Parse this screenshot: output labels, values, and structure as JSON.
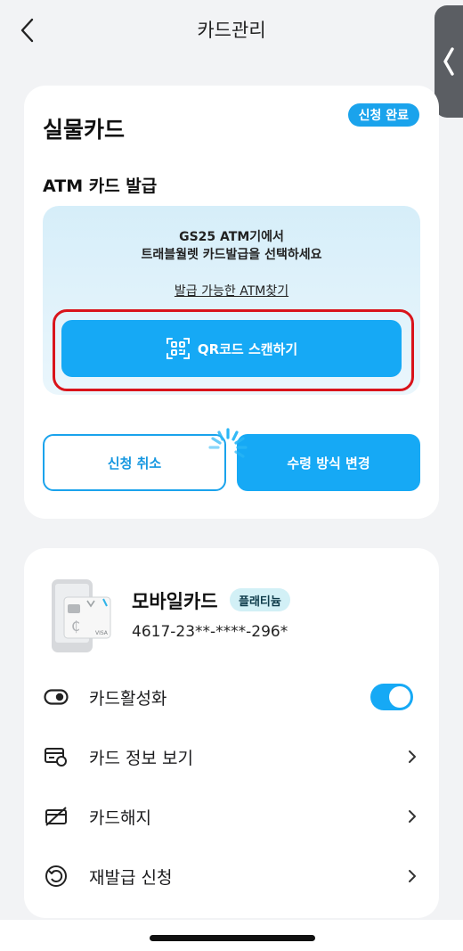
{
  "header": {
    "title": "카드관리",
    "back_icon": "chevron-left-icon",
    "handle_icon": "chevron-left-icon"
  },
  "physical_card": {
    "title": "실물카드",
    "status_badge": "신청 완료",
    "atm_section": {
      "title": "ATM 카드 발급",
      "line1": "GS25 ATM기에서",
      "line2": "트래블월렛 카드발급을 선택하세요",
      "find_link": "발급 가능한 ATM찾기",
      "qr_button": "QR코드 스캔하기",
      "qr_icon": "qr-scan-icon"
    },
    "cancel_button": "신청 취소",
    "change_button": "수령 방식 변경"
  },
  "mobile_card": {
    "name": "모바일카드",
    "tier": "플래티늄",
    "number": "4617-23**-****-296*",
    "menu": [
      {
        "label": "카드활성화",
        "icon": "toggle-icon",
        "toggle_on": true
      },
      {
        "label": "카드 정보 보기",
        "icon": "card-info-icon"
      },
      {
        "label": "카드해지",
        "icon": "card-cancel-icon"
      },
      {
        "label": "재발급 신청",
        "icon": "reissue-icon"
      }
    ]
  },
  "colors": {
    "accent": "#16a9f5",
    "highlight": "#d9141b",
    "background": "#f2f3f5"
  }
}
